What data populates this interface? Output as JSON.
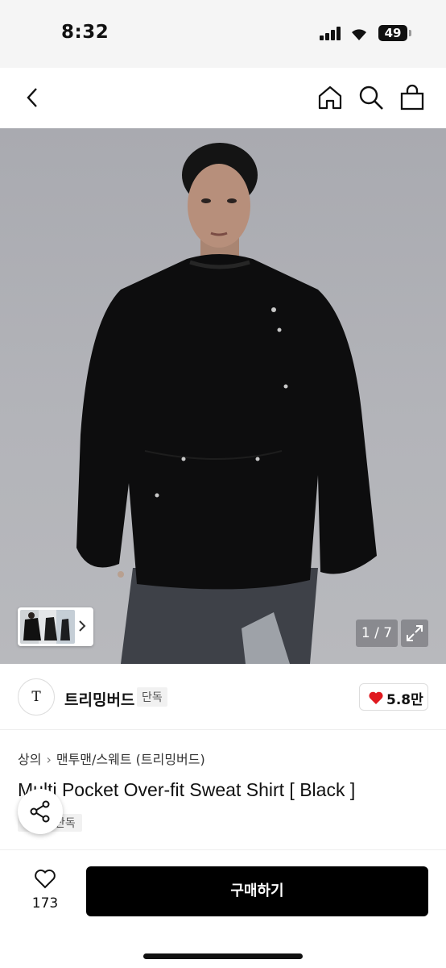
{
  "status_bar": {
    "time": "8:32",
    "battery": "49"
  },
  "nav": {
    "back_icon": "chevron-left-icon",
    "home_icon": "home-icon",
    "search_icon": "search-icon",
    "bag_icon": "shopping-bag-icon"
  },
  "gallery": {
    "counter": "1 / 7",
    "expand_icon": "expand-icon",
    "thumb_arrow_icon": "chevron-right-icon"
  },
  "brand": {
    "logo_text": "T",
    "name": "트리밍버드",
    "tag": "단독",
    "likes": "5.8만",
    "like_color": "#e0191f"
  },
  "product": {
    "breadcrumb": [
      "상의",
      "맨투맨/스웨트 (트리밍버드)"
    ],
    "title": "Multi Pocket Over-fit Sweat Shirt [ Black ]",
    "tag": "단독"
  },
  "bottom_bar": {
    "wish_count": "173",
    "buy_label": "구매하기"
  }
}
